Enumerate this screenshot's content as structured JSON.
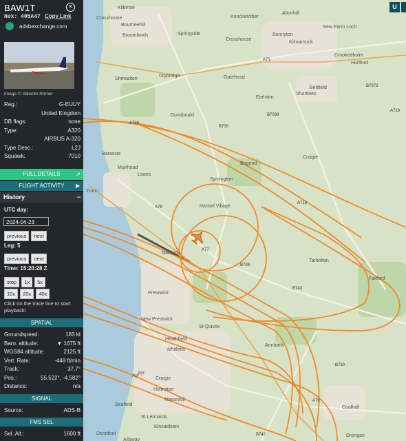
{
  "aircraft": {
    "callsign": "BAW1T",
    "hex_label": "Hex:",
    "hex": "405A47",
    "copy_link": "Copy Link",
    "source_site": "adsbexchange.com",
    "photo_credit": "Image © Valentin Römer"
  },
  "info": [
    {
      "label": "Reg.:",
      "value": "G-EUUY"
    },
    {
      "label": "",
      "value": "United Kingdom"
    },
    {
      "label": "DB flags:",
      "value": "none"
    },
    {
      "label": "Type:",
      "value": "A320"
    },
    {
      "label": "",
      "value": "AIRBUS A-320"
    },
    {
      "label": "Type Desc.:",
      "value": "L2J"
    },
    {
      "label": "Squawk:",
      "value": "7010"
    }
  ],
  "buttons": {
    "full_details": "FULL DETAILS",
    "flight_activity": "FLIGHT ACTIVITY"
  },
  "history": {
    "title": "History",
    "utc_day_label": "UTC day:",
    "date": "2024-04-23",
    "previous": "previous",
    "next": "next",
    "leg_label": "Leg: 5",
    "previous2": "previous",
    "next2": "next",
    "time_label": "Time: 15:20:28 Z",
    "stop": "stop",
    "speeds1": [
      "1x",
      "5x"
    ],
    "speeds2": [
      "10x",
      "20x",
      "40x"
    ],
    "note": "Click on the trace line to start playback!"
  },
  "spatial": {
    "title": "SPATIAL",
    "rows": [
      {
        "label": "Groundspeed:",
        "value": "183 kt"
      },
      {
        "label": "Baro. altitude:",
        "value": "▼ 1675 ft"
      },
      {
        "label": "WGS84 altitude:",
        "value": "2125 ft"
      },
      {
        "label": "Vert. Rate:",
        "value": "-448 ft/min"
      },
      {
        "label": "Track:",
        "value": "37.7°"
      },
      {
        "label": "Pos.:",
        "value": "55.522°, -4.582°"
      },
      {
        "label": "Distance:",
        "value": "n/a"
      }
    ]
  },
  "signal": {
    "title": "SIGNAL",
    "rows": [
      {
        "label": "Source:",
        "value": "ADS-B"
      }
    ]
  },
  "fms": {
    "title": "FMS SEL",
    "rows": [
      {
        "label": "Sel. Alt.:",
        "value": "1600 ft"
      }
    ]
  },
  "top_buttons": [
    "U"
  ],
  "map_labels": [
    {
      "text": "Kilbirnie"
    },
    {
      "text": "Bourtreehill"
    },
    {
      "text": "Broomlands"
    },
    {
      "text": "Springside"
    },
    {
      "text": "Knockentiber"
    },
    {
      "text": "Crosshouse"
    },
    {
      "text": "Altonhill"
    },
    {
      "text": "Bonnyton"
    },
    {
      "text": "Kilmarnock"
    },
    {
      "text": "New Farm Loch"
    },
    {
      "text": "Crookedholm"
    },
    {
      "text": "Hurlford"
    },
    {
      "text": "Shewalton"
    },
    {
      "text": "Drybridge"
    },
    {
      "text": "Gatehead"
    },
    {
      "text": "Earlston"
    },
    {
      "text": "Beitfield"
    },
    {
      "text": "Shortlees"
    },
    {
      "text": "Dundonald"
    },
    {
      "text": "Barassie"
    },
    {
      "text": "Muirhead"
    },
    {
      "text": "Loans"
    },
    {
      "text": "Troon"
    },
    {
      "text": "Symington"
    },
    {
      "text": "Hansel Village"
    },
    {
      "text": "Craigie"
    },
    {
      "text": "Bogend"
    },
    {
      "text": "Monkton"
    },
    {
      "text": "Prestwick"
    },
    {
      "text": "New Prestwick"
    },
    {
      "text": "Tarbolton"
    },
    {
      "text": "Failford"
    },
    {
      "text": "St Quivox"
    },
    {
      "text": "Heathfield"
    },
    {
      "text": "Whitletts"
    },
    {
      "text": "Annbank"
    },
    {
      "text": "Ayr"
    },
    {
      "text": "Craigie"
    },
    {
      "text": "Holmston"
    },
    {
      "text": "Masonhill"
    },
    {
      "text": "Seafield"
    },
    {
      "text": "St Leonards"
    },
    {
      "text": "Coalhall"
    },
    {
      "text": "Kincaidston"
    },
    {
      "text": "Doonfoot"
    },
    {
      "text": "Alloway"
    },
    {
      "text": "Drongan"
    },
    {
      "text": "Crosshouse"
    },
    {
      "text": "Ayr"
    }
  ],
  "road_labels": [
    "A71",
    "A759",
    "B730",
    "B7038",
    "A719",
    "A78",
    "A77",
    "B739",
    "B743",
    "B730",
    "A70",
    "B7073",
    "A719",
    "B742"
  ],
  "colors": {
    "panel": "#23272c",
    "accent": "#1e6c78",
    "green": "#2ec486",
    "trace": "#f0892a"
  }
}
